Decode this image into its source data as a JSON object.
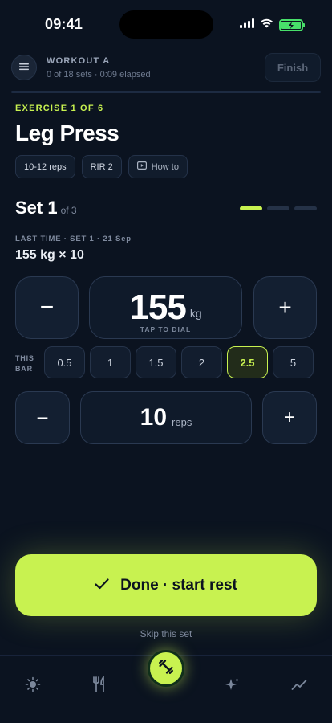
{
  "status_bar": {
    "time": "09:41"
  },
  "header": {
    "workout_name": "WORKOUT A",
    "progress_text": "0 of 18 sets · 0:09 elapsed",
    "finish_label": "Finish",
    "progress_fraction": 0
  },
  "exercise": {
    "label": "EXERCISE 1 OF 6",
    "name": "Leg Press",
    "chips": {
      "reps": "10-12 reps",
      "rir": "RIR 2",
      "howto": "How to"
    }
  },
  "set": {
    "title": "Set 1",
    "of": "of 3",
    "total": 3,
    "current": 1
  },
  "last_time": {
    "label": "LAST TIME · SET 1 · 21 Sep",
    "value": "155 kg × 10"
  },
  "weight": {
    "minus": "−",
    "plus": "+",
    "value": "155",
    "unit": "kg",
    "hint": "TAP TO DIAL"
  },
  "bar": {
    "label_line1": "THIS",
    "label_line2": "BAR",
    "increments": [
      "0.5",
      "1",
      "1.5",
      "2",
      "2.5",
      "5"
    ],
    "selected": "2.5"
  },
  "reps": {
    "minus": "−",
    "plus": "+",
    "value": "10",
    "unit": "reps"
  },
  "actions": {
    "done_label": "Done · start rest",
    "skip_label": "Skip this set"
  },
  "tabbar": {
    "icons": [
      "sun-icon",
      "fork-knife-icon",
      "dumbbell-icon",
      "sparkles-icon",
      "trend-line-icon"
    ],
    "active": "dumbbell-icon"
  },
  "colors": {
    "accent": "#c8f250",
    "background": "#0b1320",
    "battery": "#48e06a"
  }
}
